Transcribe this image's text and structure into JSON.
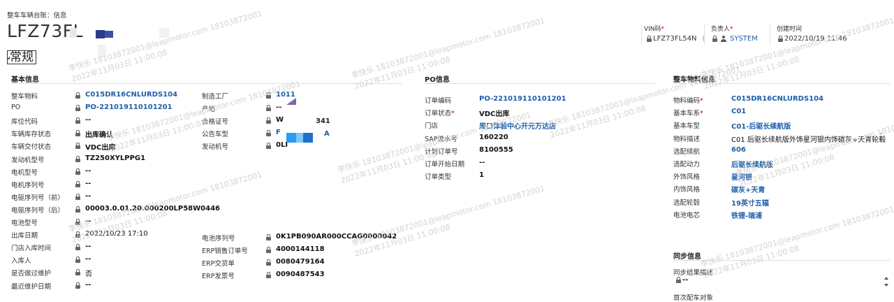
{
  "breadcrumb": "整车车辆台账：信息",
  "record_title": "LFZ73FL",
  "tab_general": "常规",
  "header_fields": [
    {
      "label": "VIN码",
      "required": true,
      "value": "LFZ73FL54N",
      "icon": "lock-icon",
      "tail": "("
    },
    {
      "label": "负责人",
      "required": true,
      "value": "SYSTEM",
      "icon": "lock-icon"
    },
    {
      "label": "创建时间",
      "required": false,
      "value": "2022/10/19   11:46",
      "icon": "lock-icon"
    }
  ],
  "required_mark": "*",
  "basic": {
    "title": "基本信息",
    "left": [
      {
        "label": "整车物料",
        "value": "C015DR16CNLURDS104",
        "link": true
      },
      {
        "label": "PO",
        "value": "PO-221019110101201",
        "link": true
      },
      {
        "label": "库位代码",
        "value": "--"
      },
      {
        "label": "车辆库存状态",
        "value": "出库确认"
      },
      {
        "label": "车辆交付状态",
        "value": "VDC出库"
      },
      {
        "label": "发动机型号",
        "value": "TZ250XYLPPG1"
      },
      {
        "label": "电机型号",
        "value": "--"
      },
      {
        "label": "电机序列号",
        "value": "--"
      },
      {
        "label": "电驱序列号（前）",
        "value": "--"
      },
      {
        "label": "电驱序列号（后）",
        "value": "00003.0.01.20.000200LP58W0446"
      },
      {
        "label": "电池型号",
        "value": "--"
      },
      {
        "label": "出库日期",
        "value": "2022/10/23   17:10",
        "plain": true
      },
      {
        "label": "门店入库时间",
        "value": "--"
      },
      {
        "label": "入库人",
        "value": "--"
      },
      {
        "label": "是否做过维护",
        "value": "否",
        "plain": true
      },
      {
        "label": "最近维护日期",
        "value": "--"
      }
    ],
    "right": [
      {
        "label": "制造工厂",
        "value": "1011",
        "link": true
      },
      {
        "label": "产地",
        "value": "--"
      },
      {
        "label": "合格证号",
        "value": "W"
      },
      {
        "label": "公告车型",
        "value": "F",
        "link": true
      },
      {
        "label": "发动机号",
        "value": "0LI"
      }
    ],
    "right_partial_tails": {
      "cert_tail": "341",
      "model_tail": "A"
    },
    "right_lower": [
      {
        "label": "电池序列号",
        "value": "0K1PB090AR000CCAG0000042"
      },
      {
        "label": "ERP销售订单号",
        "value": "4000144118"
      },
      {
        "label": "ERP交货单",
        "value": "0080479164"
      },
      {
        "label": "ERP发票号",
        "value": "0090487543"
      }
    ]
  },
  "po": {
    "title": "PO信息",
    "rows": [
      {
        "label": "订单编码",
        "value": "PO-221019110101201",
        "link": true,
        "required": false
      },
      {
        "label": "订单状态",
        "value": "VDC出库",
        "required": true
      },
      {
        "label": "门店",
        "value": "周口体验中心开元万达店",
        "link": true
      },
      {
        "label": "SAP流水号",
        "value": "160220"
      },
      {
        "label": "计划订单号",
        "value": "8100555"
      },
      {
        "label": "订单开始日期",
        "value": "--"
      },
      {
        "label": "订单类型",
        "value": "1"
      }
    ]
  },
  "material": {
    "title": "整车物料信息",
    "rows": [
      {
        "label": "物料编码",
        "value": "C015DR16CNLURDS104",
        "link": true,
        "required": true
      },
      {
        "label": "基本车系",
        "value": "C01",
        "link": true,
        "required": true
      },
      {
        "label": "基本车型",
        "value": "C01-后驱长续航版",
        "link": true
      },
      {
        "label": "物料描述",
        "value": "C01 后驱长续航版外饰星河银内饰碳灰+天青轮毂",
        "plain": true
      },
      {
        "label": "选配续航",
        "value": "606",
        "link": true
      },
      {
        "label": "选配动力",
        "value": "后驱长续航版",
        "link": true
      },
      {
        "label": "外饰风格",
        "value": "星河银",
        "link": true
      },
      {
        "label": "内饰风格",
        "value": "碳灰+天青",
        "link": true
      },
      {
        "label": "选配轮毂",
        "value": "19英寸五辐",
        "link": true
      },
      {
        "label": "电池电芯",
        "value": "铁锂-瑞浦",
        "link": true
      }
    ],
    "more": "⋮"
  },
  "sync": {
    "title": "同步信息",
    "rows": [
      {
        "label": "同步结果描述",
        "value": "--"
      },
      {
        "label": "首次配车对象",
        "value": ""
      }
    ]
  },
  "watermark": {
    "line1": "李快乐 18103872001@leapmotor.com 18103872001",
    "line2": "2022年11月03日 11:00:08"
  }
}
